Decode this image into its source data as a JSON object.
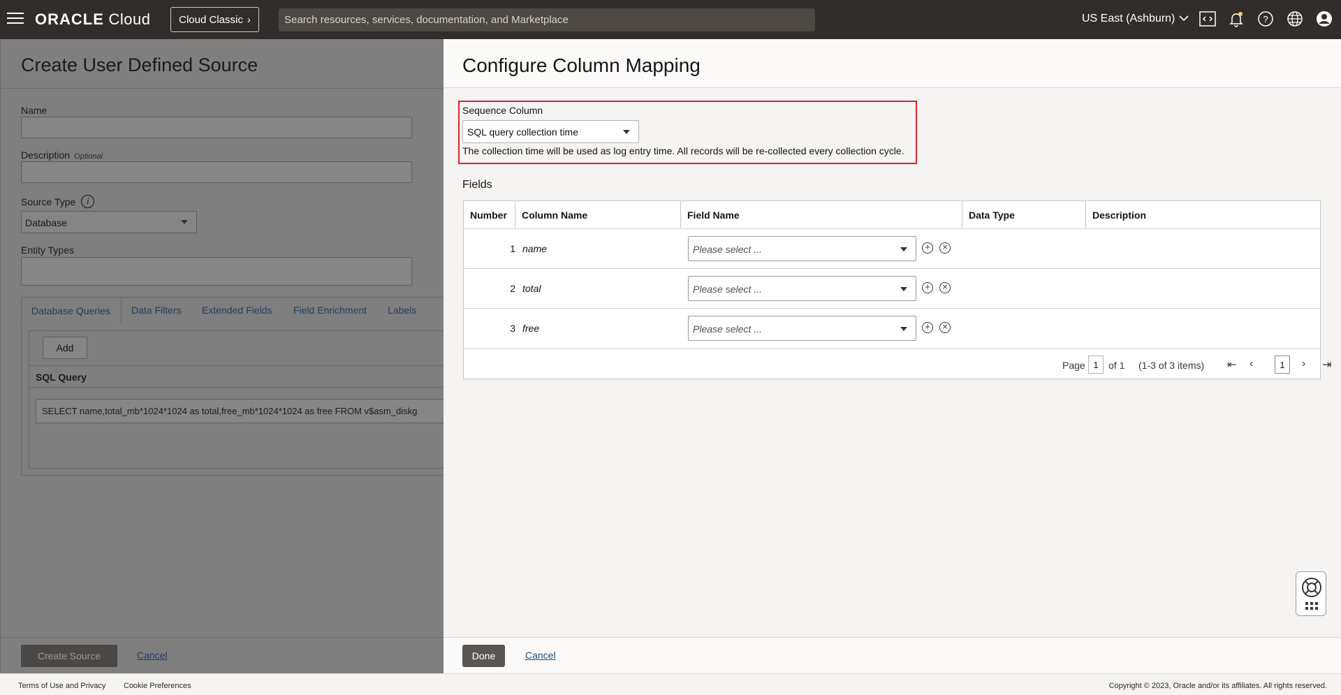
{
  "header": {
    "brand_bold": "ORACLE",
    "brand_light": "Cloud",
    "classic_label": "Cloud Classic",
    "search_placeholder": "Search resources, services, documentation, and Marketplace",
    "region": "US East (Ashburn)"
  },
  "left": {
    "title": "Create User Defined Source",
    "name_label": "Name",
    "description_label": "Description",
    "optional": "Optional",
    "source_type_label": "Source Type",
    "source_type_value": "Database",
    "entity_types_label": "Entity Types",
    "tabs": [
      "Database Queries",
      "Data Filters",
      "Extended Fields",
      "Field Enrichment",
      "Labels"
    ],
    "add_label": "Add",
    "sql_header": "SQL Query",
    "sql_value": "SELECT name,total_mb*1024*1024 as total,free_mb*1024*1024 as free FROM v$asm_diskg",
    "create_label": "Create Source",
    "cancel_label": "Cancel"
  },
  "right": {
    "title": "Configure Column Mapping",
    "sequence_label": "Sequence Column",
    "sequence_value": "SQL query collection time",
    "sequence_help": "The collection time will be used as log entry time. All records will be re-collected every collection cycle.",
    "fields_label": "Fields",
    "columns": [
      "Number",
      "Column Name",
      "Field Name",
      "Data Type",
      "Description"
    ],
    "rows": [
      {
        "number": "1",
        "column": "name",
        "field_placeholder": "Please select ..."
      },
      {
        "number": "2",
        "column": "total",
        "field_placeholder": "Please select ..."
      },
      {
        "number": "3",
        "column": "free",
        "field_placeholder": "Please select ..."
      }
    ],
    "pager": {
      "page_label": "Page",
      "page_value": "1",
      "of_label": "of 1",
      "items": "(1-3 of 3 items)",
      "current": "1"
    },
    "done_label": "Done",
    "cancel_label": "Cancel"
  },
  "footer": {
    "terms": "Terms of Use and Privacy",
    "cookies": "Cookie Preferences",
    "copyright": "Copyright © 2023, Oracle and/or its affiliates. All rights reserved."
  },
  "colors": {
    "topbar": "#312d2a",
    "highlight": "#d9242a",
    "link": "#1f4f7a"
  }
}
